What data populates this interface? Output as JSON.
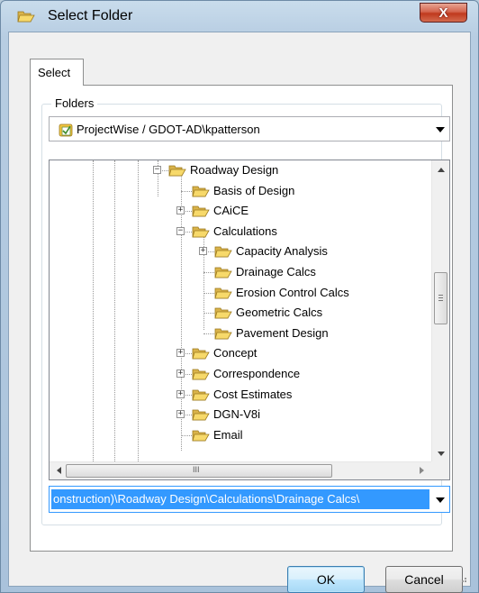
{
  "window": {
    "title": "Select Folder",
    "close_glyph": "X"
  },
  "tabs": [
    {
      "label": "Select"
    }
  ],
  "folders_group": {
    "label": "Folders",
    "datasource": "ProjectWise / GDOT-AD\\kpatterson"
  },
  "tree": {
    "nodes": [
      {
        "label": "Roadway Design",
        "expander": "−"
      },
      {
        "label": "Basis of Design",
        "expander": ""
      },
      {
        "label": "CAiCE",
        "expander": "+"
      },
      {
        "label": "Calculations",
        "expander": "−"
      },
      {
        "label": "Capacity Analysis",
        "expander": "+"
      },
      {
        "label": "Drainage Calcs",
        "expander": ""
      },
      {
        "label": "Erosion Control Calcs",
        "expander": ""
      },
      {
        "label": "Geometric Calcs",
        "expander": ""
      },
      {
        "label": "Pavement Design",
        "expander": ""
      },
      {
        "label": "Concept",
        "expander": "+"
      },
      {
        "label": "Correspondence",
        "expander": "+"
      },
      {
        "label": "Cost Estimates",
        "expander": "+"
      },
      {
        "label": "DGN-V8i",
        "expander": "+"
      },
      {
        "label": "Email",
        "expander": ""
      }
    ],
    "selected": "Drainage Calcs",
    "hscroll_grip": "III"
  },
  "path_combo": {
    "value": "onstruction)\\Roadway Design\\Calculations\\Drainage Calcs\\"
  },
  "buttons": {
    "ok": "OK",
    "cancel": "Cancel"
  },
  "colors": {
    "selection": "#3399ff",
    "folder_yellow": "#f5d264",
    "close_red": "#c7432a"
  }
}
